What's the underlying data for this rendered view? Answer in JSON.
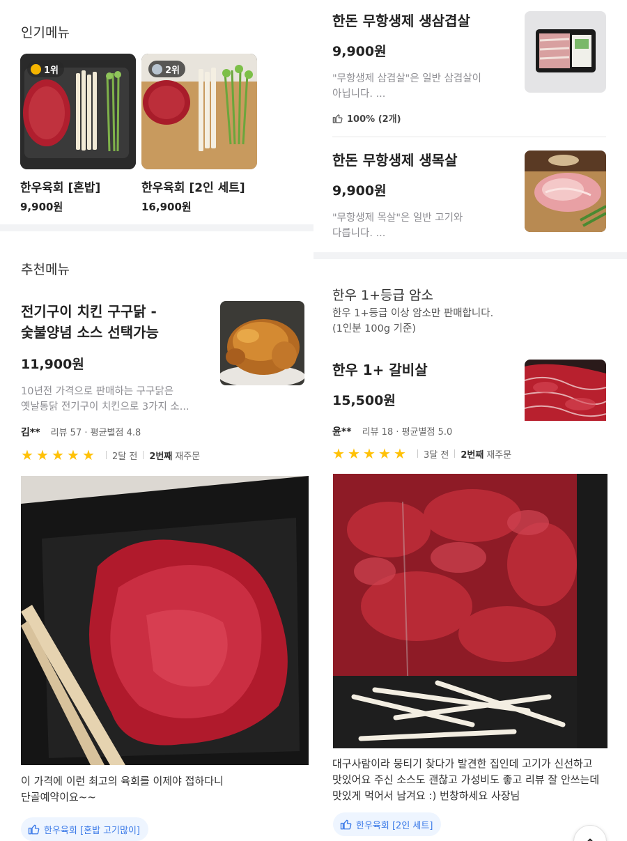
{
  "popular": {
    "title": "인기메뉴",
    "items": [
      {
        "rank": "1위",
        "name": "한우육회 [혼밥]",
        "price": "9,900원"
      },
      {
        "rank": "2위",
        "name": "한우육회 [2인 세트]",
        "price": "16,900원"
      }
    ]
  },
  "recommended": {
    "title": "추천메뉴",
    "item": {
      "name_line1": "전기구이 치킨 구구닭 -",
      "name_line2": "숯불양념 소스 선택가능",
      "price": "11,900원",
      "desc_line1": "10년전 가격으로 판매하는 구구닭은",
      "desc_line2": "옛날통닭 전기구이 치킨으로 3가지 소..."
    },
    "review": {
      "reviewer": "김**",
      "meta": "리뷰 57 · 평균별점 4.8",
      "stars": 5,
      "time": "2달 전",
      "reorder_count": "2번째",
      "reorder_label": "재주문",
      "text_line1": "이 가격에 이런 최고의 육회를 이제야 접하다니",
      "text_line2": "단골예약이요~~",
      "tag": "한우육회 [혼밥 고기많이]"
    }
  },
  "right_items": [
    {
      "name": "한돈 무항생제 생삼겹살",
      "price": "9,900원",
      "desc_line1": "\"무항생제 삼겹살\"은 일반 삼겹살이",
      "desc_line2": "아닙니다. ...",
      "like": "100% (2개)"
    },
    {
      "name": "한돈 무항생제 생목살",
      "price": "9,900원",
      "desc_line1": "\"무항생제 목살\"은 일반 고기와",
      "desc_line2": "다릅니다. ..."
    }
  ],
  "hanwoo": {
    "title": "한우 1+등급 암소",
    "desc_line1": "한우 1+등급 이상 암소만 판매합니다.",
    "desc_line2": "(1인분 100g 기준)",
    "item": {
      "name": "한우 1+ 갈비살",
      "price": "15,500원"
    },
    "review": {
      "reviewer": "윤**",
      "meta": "리뷰 18 · 평균별점 5.0",
      "stars": 5,
      "time": "3달 전",
      "reorder_count": "2번째",
      "reorder_label": "재주문",
      "text_line1": "대구사람이라 뭉티기 찾다가 발견한 집인데 고기가 신선하고",
      "text_line2": "맛있어요 주신 소스도 괜찮고 가성비도 좋고 리뷰 잘 안쓰는데",
      "text_line3": "맛있게 먹어서 남겨요 :) 번창하세요 사장님",
      "tag": "한우육회 [2인 세트]"
    }
  },
  "icons": {
    "star": "star-icon",
    "like": "thumbs-up-icon",
    "scroll_top": "chevron-up-icon"
  },
  "colors": {
    "star": "#ffc107",
    "tag_bg": "#eef5ff",
    "tag_text": "#3b7ae8"
  }
}
